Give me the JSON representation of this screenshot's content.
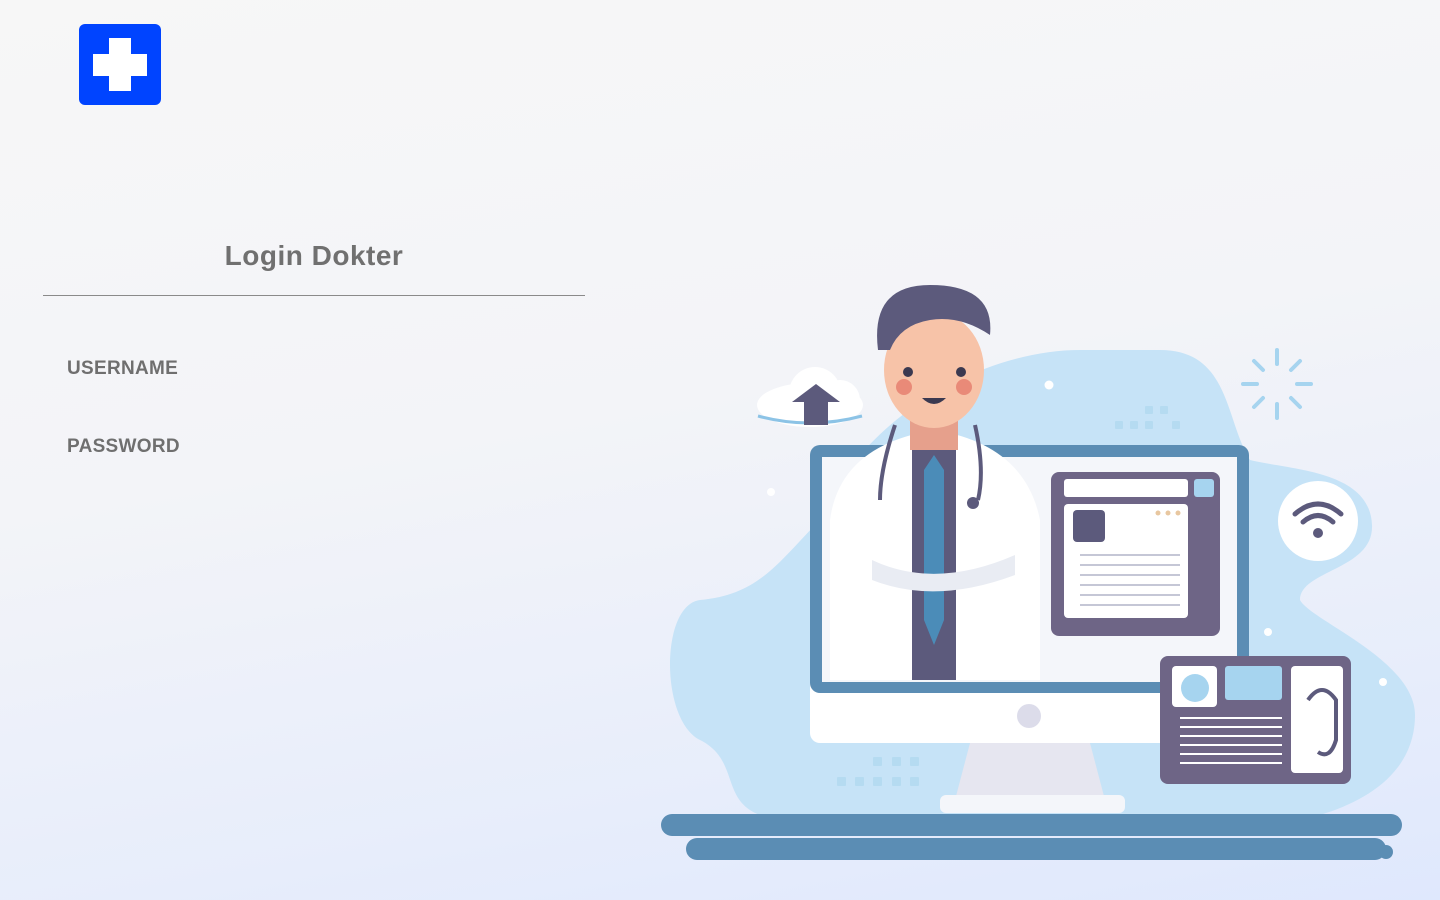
{
  "logo": {
    "icon": "medical-cross-icon",
    "color": "#0044ff"
  },
  "login": {
    "title": "Login Dokter",
    "username_label": "USERNAME",
    "password_label": "PASSWORD",
    "username_value": "",
    "password_value": ""
  },
  "illustration": {
    "icon": "doctor-telemedicine-illustration"
  }
}
